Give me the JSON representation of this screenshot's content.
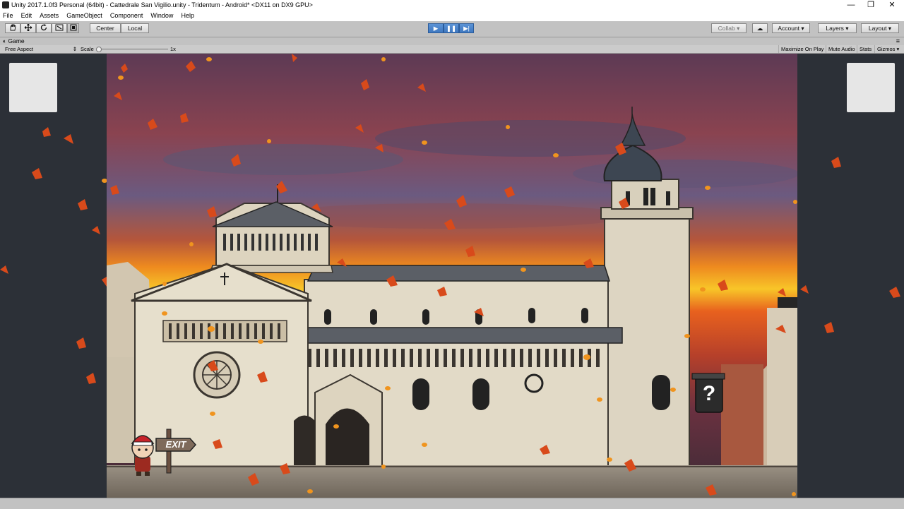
{
  "window": {
    "title": "Unity 2017.1.0f3 Personal (64bit) - Cattedrale San Vigilio.unity - Tridentum - Android* <DX11 on DX9 GPU>",
    "controls": [
      "—",
      "❐",
      "✕"
    ]
  },
  "menu": [
    "File",
    "Edit",
    "Assets",
    "GameObject",
    "Component",
    "Window",
    "Help"
  ],
  "toolbar": {
    "tools": [
      "hand-icon",
      "move-icon",
      "rotate-icon",
      "scale-icon",
      "rect-icon"
    ],
    "pivot_center": "Center",
    "pivot_local": "Local",
    "play": "▶",
    "pause": "❚❚",
    "step": "▶|",
    "collab": "Collab ▾",
    "cloud": "☁",
    "account": "Account ▾",
    "layers": "Layers ▾",
    "layout": "Layout ▾"
  },
  "game_panel": {
    "tab_label": "Game",
    "aspect": "Free Aspect",
    "scale_label": "Scale",
    "scale_value": "1x",
    "options": [
      "Maximize On Play",
      "Mute Audio",
      "Stats",
      "Gizmos ▾"
    ]
  },
  "scene": {
    "exit_sign": "EXIT",
    "mystery_symbol": "?"
  },
  "colors": {
    "chrome": "#c2c2c2",
    "play_accent": "#4a86cf",
    "leaf": "#d84a1b"
  }
}
